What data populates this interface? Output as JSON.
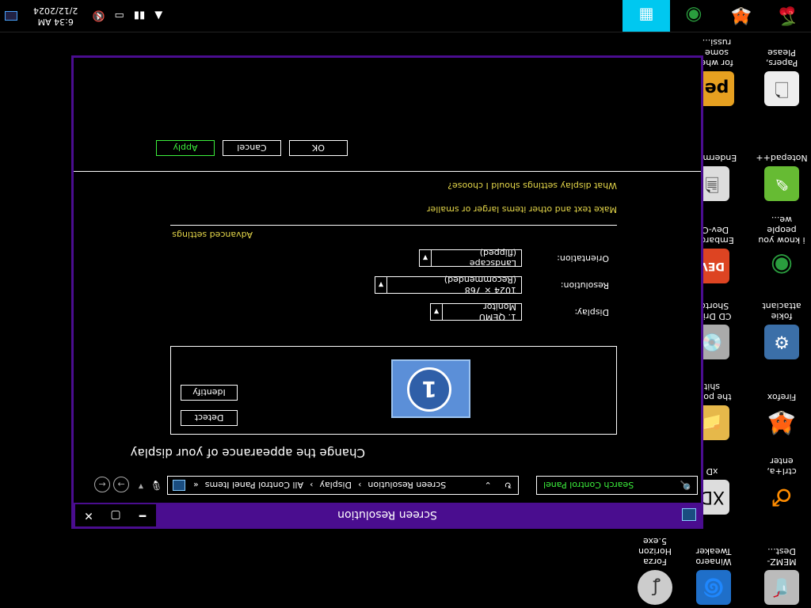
{
  "taskbar": {
    "time": "6:34 AM",
    "date": "2/12/2024",
    "pinned": [
      {
        "name": "cherry-icon",
        "glyph": "🍒",
        "color": "#c00"
      },
      {
        "name": "firefox-icon",
        "glyph": "🦊",
        "color": "#ff7a00"
      },
      {
        "name": "chrome-icon",
        "glyph": "◉",
        "color": "#2a9d3e"
      },
      {
        "name": "control-panel-icon",
        "glyph": "▦",
        "color": "#0af"
      }
    ]
  },
  "desktop": {
    "icons": [
      {
        "label": "MEMZ-Dest..."
      },
      {
        "label": "Winaero Tweaker"
      },
      {
        "label": "Forza Horizon 5.exe"
      },
      {
        "label": "ctrl+a, enter"
      },
      {
        "label": "xD"
      },
      {
        "label": "Firefox"
      },
      {
        "label": "the popo shit"
      },
      {
        "label": "fokie attaciant"
      },
      {
        "label": "CD Drive Shortcu"
      },
      {
        "label": "i know you people we..."
      },
      {
        "label": "Embarcad Dev-C+"
      },
      {
        "label": "Notepad++"
      },
      {
        "label": "Endermanc"
      },
      {
        "label": "Papers, Please"
      },
      {
        "label": "for whe some russi..."
      }
    ]
  },
  "window": {
    "title": "Screen Resolution",
    "address": {
      "prefix": "«",
      "crumbs": [
        "All Control Panel Items",
        "Display",
        "Screen Resolution"
      ]
    },
    "search_placeholder": "Search Control Panel",
    "heading": "Change the appearance of your display",
    "detect_label": "Detect",
    "identify_label": "Identify",
    "monitor_number": "1",
    "display_label": "Display:",
    "display_value": "1. QEMU Monitor",
    "resolution_label": "Resolution:",
    "resolution_value": "1024 × 768 (Recommended)",
    "orientation_label": "Orientation:",
    "orientation_value": "Landscape (flipped)",
    "advanced_link": "Advanced settings",
    "link_text_size": "Make text and other items larger or smaller",
    "link_help": "What display settings should I choose?",
    "ok_label": "OK",
    "cancel_label": "Cancel",
    "apply_label": "Apply"
  }
}
